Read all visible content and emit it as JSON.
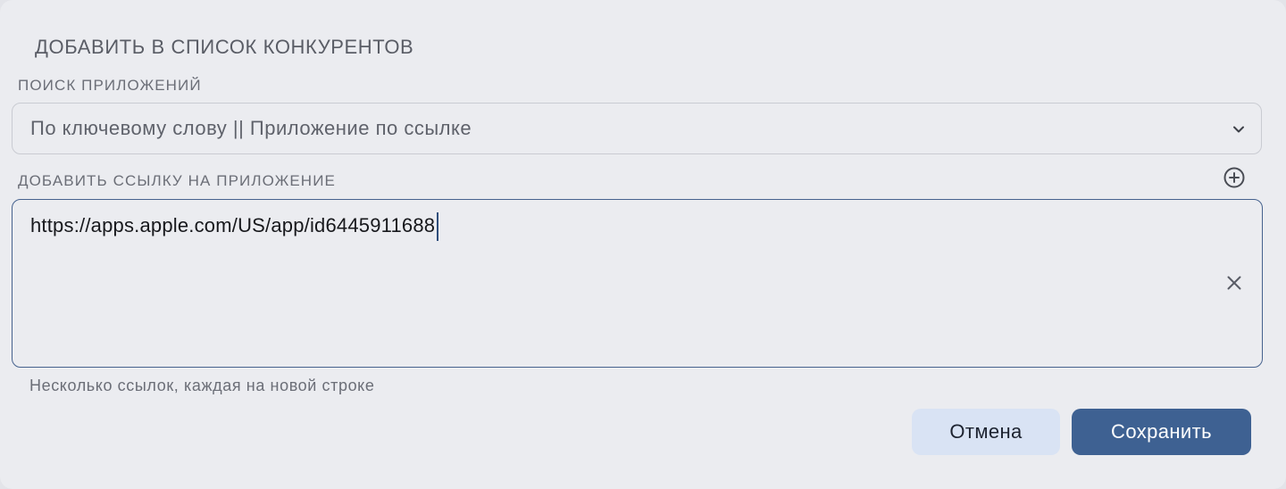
{
  "dialog": {
    "title": "ДОБАВИТЬ В СПИСОК КОНКУРЕНТОВ"
  },
  "search": {
    "label": "ПОИСК ПРИЛОЖЕНИЙ",
    "selected_value": "По ключевому слову || Приложение по ссылке",
    "icon": "chevron-down-icon"
  },
  "link_field": {
    "label": "ДОБАВИТЬ ССЫЛКУ НА ПРИЛОЖЕНИЕ",
    "add_icon": "plus-circle-icon",
    "value": "https://apps.apple.com/US/app/id6445911688",
    "clear_icon": "close-icon",
    "helper_text": "Несколько ссылок, каждая на новой строке",
    "focus_color": "#46628e"
  },
  "actions": {
    "cancel_label": "Отмена",
    "save_label": "Сохранить",
    "cancel_bg": "#d9e3f4",
    "save_bg": "#3e6192"
  }
}
